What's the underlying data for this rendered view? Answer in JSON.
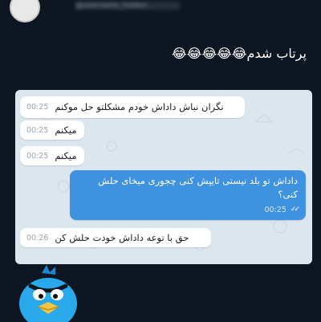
{
  "post": {
    "username": "@username_hidden",
    "caption": "پرتاب شدم😂😂😂😂😂"
  },
  "chat": {
    "messages": [
      {
        "text": "نگران نباش داداش خودم مشکلتو حل موکنم",
        "time": "00:25"
      },
      {
        "text": "میکنم",
        "time": "00:25"
      },
      {
        "text": "میکنم",
        "time": "00:25"
      },
      {
        "line1": "داداش تو بلد نیستی تایپش کنی چجوری میخای حلش",
        "line2": "کنی؟",
        "time": "00:25"
      },
      {
        "text": "حق با توعه داداش خودت حلش کن",
        "time": "00:26"
      }
    ]
  },
  "colors": {
    "background": "#0e1621",
    "chat_background": "#dbe6ee",
    "outgoing_bubble": "#3f92e0",
    "incoming_bubble": "#ffffff",
    "mascot": "#29a8ec"
  },
  "icons": [
    "avatar",
    "double-check-icon",
    "angry-bird-mascot-icon"
  ]
}
